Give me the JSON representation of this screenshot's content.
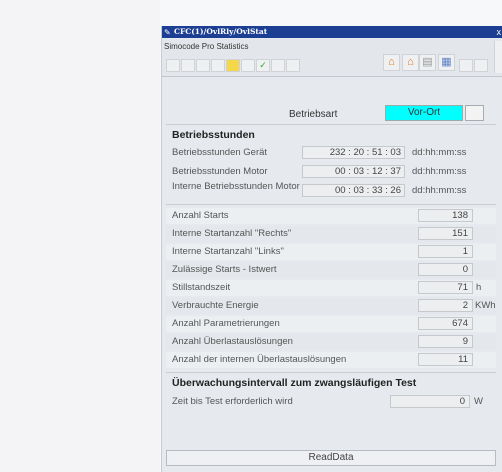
{
  "window": {
    "title": "CFC(1)/OvlRly/OvlStat",
    "close": "x"
  },
  "toolbar": {
    "label": "Simocode Pro Statistics"
  },
  "betriebsart": {
    "label": "Betriebsart",
    "value": "Vor-Ort"
  },
  "betriebsstunden": {
    "heading": "Betriebsstunden",
    "rows": [
      {
        "label": "Betriebsstunden Gerät",
        "value": "232 : 20 : 51 : 03",
        "unit": "dd:hh:mm:ss"
      },
      {
        "label": "Betriebsstunden Motor",
        "value": "00 : 03 : 12 : 37",
        "unit": "dd:hh:mm:ss"
      },
      {
        "label": "Interne Betriebsstunden Motor",
        "value": "00 : 03 : 33 : 26",
        "unit": "dd:hh:mm:ss"
      }
    ]
  },
  "stats": [
    {
      "label": "Anzahl Starts",
      "value": "138",
      "unit": ""
    },
    {
      "label": "Interne Startanzahl \"Rechts\"",
      "value": "151",
      "unit": ""
    },
    {
      "label": "Interne Startanzahl \"Links\"",
      "value": "1",
      "unit": ""
    },
    {
      "label": "Zulässige Starts - Istwert",
      "value": "0",
      "unit": ""
    },
    {
      "label": "Stillstandszeit",
      "value": "71",
      "unit": "h"
    },
    {
      "label": "Verbrauchte Energie",
      "value": "2",
      "unit": "KWh"
    },
    {
      "label": "Anzahl Parametrierungen",
      "value": "674",
      "unit": ""
    },
    {
      "label": "Anzahl Überlastauslösungen",
      "value": "9",
      "unit": ""
    },
    {
      "label": "Anzahl der internen Überlastauslösungen",
      "value": "11",
      "unit": ""
    }
  ],
  "test": {
    "heading": "Überwachungsintervall zum zwangsläufigen Test",
    "label": "Zeit bis Test erforderlich wird",
    "value": "0",
    "unit": "W"
  },
  "readdata": {
    "label": "ReadData"
  },
  "colors": {
    "titlebar": "#1c3f93",
    "mode_active": "#00ffff"
  }
}
